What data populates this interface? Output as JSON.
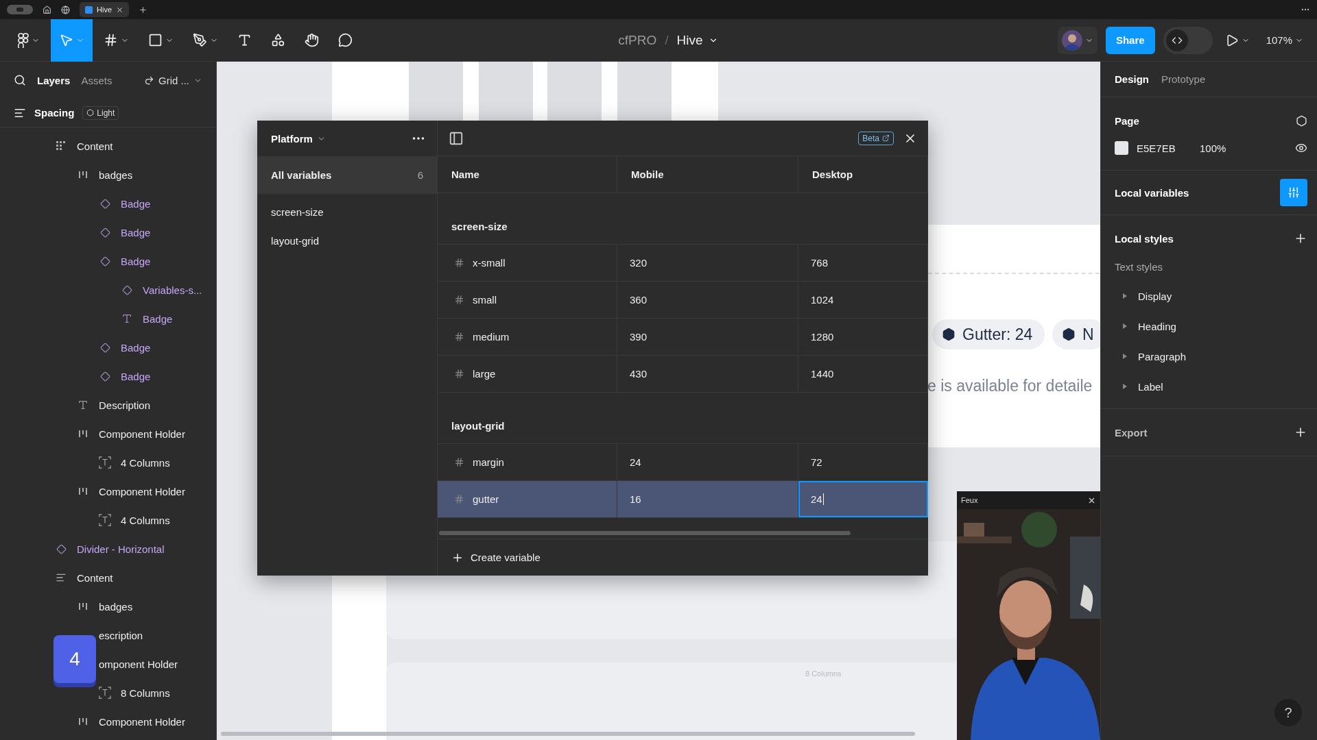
{
  "browser_tabs": [
    {
      "label": "Hive",
      "selected": true
    }
  ],
  "toolbar": {
    "tools": [
      {
        "kind": "main-menu",
        "selected": false,
        "dropdown": true
      },
      {
        "kind": "move",
        "selected": true,
        "dropdown": true
      },
      {
        "kind": "frame",
        "selected": false,
        "dropdown": true
      },
      {
        "kind": "shape",
        "selected": false,
        "dropdown": true
      },
      {
        "kind": "pen",
        "selected": false,
        "dropdown": true
      },
      {
        "kind": "text",
        "selected": false,
        "dropdown": false
      },
      {
        "kind": "resources",
        "selected": false,
        "dropdown": false
      },
      {
        "kind": "hand",
        "selected": false,
        "dropdown": false
      },
      {
        "kind": "comment",
        "selected": false,
        "dropdown": false
      }
    ],
    "file": {
      "project": "cfPRO",
      "separator": "/",
      "name": "Hive"
    },
    "share": "Share",
    "dev_mode": {
      "on": false
    },
    "zoom": "107%"
  },
  "left_panel": {
    "tabs": [
      {
        "label": "Layers",
        "selected": true
      },
      {
        "label": "Assets",
        "selected": false
      }
    ],
    "page_picker": "Grid ...",
    "page": {
      "name": "Spacing",
      "mode": "Light"
    },
    "layers": [
      {
        "name": "Content",
        "kind": "grid",
        "children": [
          {
            "name": "badges",
            "kind": "hstack",
            "children": [
              {
                "name": "Badge",
                "kind": "instance"
              },
              {
                "name": "Badge",
                "kind": "instance"
              },
              {
                "name": "Badge",
                "kind": "instance",
                "children": [
                  {
                    "name": "Variables-s...",
                    "kind": "instance"
                  },
                  {
                    "name": "Badge",
                    "kind": "instance-text"
                  }
                ]
              },
              {
                "name": "Badge",
                "kind": "instance"
              },
              {
                "name": "Badge",
                "kind": "instance"
              }
            ]
          },
          {
            "name": "Description",
            "kind": "text"
          },
          {
            "name": "Component Holder",
            "kind": "hstack",
            "children": [
              {
                "name": "4 Columns",
                "kind": "textbox"
              }
            ]
          },
          {
            "name": "Component Holder",
            "kind": "hstack",
            "children": [
              {
                "name": "4 Columns",
                "kind": "textbox"
              }
            ]
          }
        ]
      },
      {
        "name": "Divider - Horizontal",
        "kind": "instance"
      },
      {
        "name": "Content",
        "kind": "vstack",
        "children": [
          {
            "name": "badges",
            "kind": "hstack"
          },
          {
            "name": "escription",
            "kind": "covered"
          },
          {
            "name": "omponent Holder",
            "kind": "covered",
            "children": [
              {
                "name": "8 Columns",
                "kind": "textbox"
              }
            ]
          },
          {
            "name": "Component Holder",
            "kind": "hstack"
          }
        ]
      }
    ],
    "keystroke": "4"
  },
  "canvas": {
    "badges": [
      {
        "label": "Gutter: 24"
      },
      {
        "label": "N"
      }
    ],
    "description": "e is available for detaile",
    "card_label": "8 Columns"
  },
  "variables_dialog": {
    "collection": "Platform",
    "beta": "Beta",
    "groups": [
      {
        "label": "All variables",
        "count": "6",
        "selected": true
      },
      {
        "label": "screen-size",
        "selected": false
      },
      {
        "label": "layout-grid",
        "selected": false
      }
    ],
    "columns": [
      "Name",
      "Mobile",
      "Desktop"
    ],
    "sections": [
      {
        "title": "screen-size",
        "rows": [
          {
            "name": "x-small",
            "selected": false,
            "values": [
              {
                "text": "320",
                "editing": false
              },
              {
                "text": "768",
                "editing": false
              }
            ]
          },
          {
            "name": "small",
            "selected": false,
            "values": [
              {
                "text": "360",
                "editing": false
              },
              {
                "text": "1024",
                "editing": false
              }
            ]
          },
          {
            "name": "medium",
            "selected": false,
            "values": [
              {
                "text": "390",
                "editing": false
              },
              {
                "text": "1280",
                "editing": false
              }
            ]
          },
          {
            "name": "large",
            "selected": false,
            "values": [
              {
                "text": "430",
                "editing": false
              },
              {
                "text": "1440",
                "editing": false
              }
            ]
          }
        ]
      },
      {
        "title": "layout-grid",
        "rows": [
          {
            "name": "margin",
            "selected": false,
            "values": [
              {
                "text": "24",
                "editing": false
              },
              {
                "text": "72",
                "editing": false
              }
            ]
          },
          {
            "name": "gutter",
            "selected": true,
            "values": [
              {
                "text": "16",
                "editing": false
              },
              {
                "text": "24",
                "editing": true
              }
            ]
          }
        ]
      }
    ],
    "create": "Create variable"
  },
  "video": {
    "title": "Feux",
    "kind": "picture"
  },
  "right_panel": {
    "tabs": [
      {
        "label": "Design",
        "selected": true
      },
      {
        "label": "Prototype",
        "selected": false
      }
    ],
    "page": {
      "title": "Page",
      "color": "#e5e7eb",
      "hex": "E5E7EB",
      "opacity": "100%"
    },
    "local_variables": "Local variables",
    "local_styles": "Local styles",
    "text_styles": {
      "title": "Text styles",
      "items": [
        "Display",
        "Heading",
        "Paragraph",
        "Label"
      ]
    },
    "export": "Export",
    "help": "?"
  }
}
